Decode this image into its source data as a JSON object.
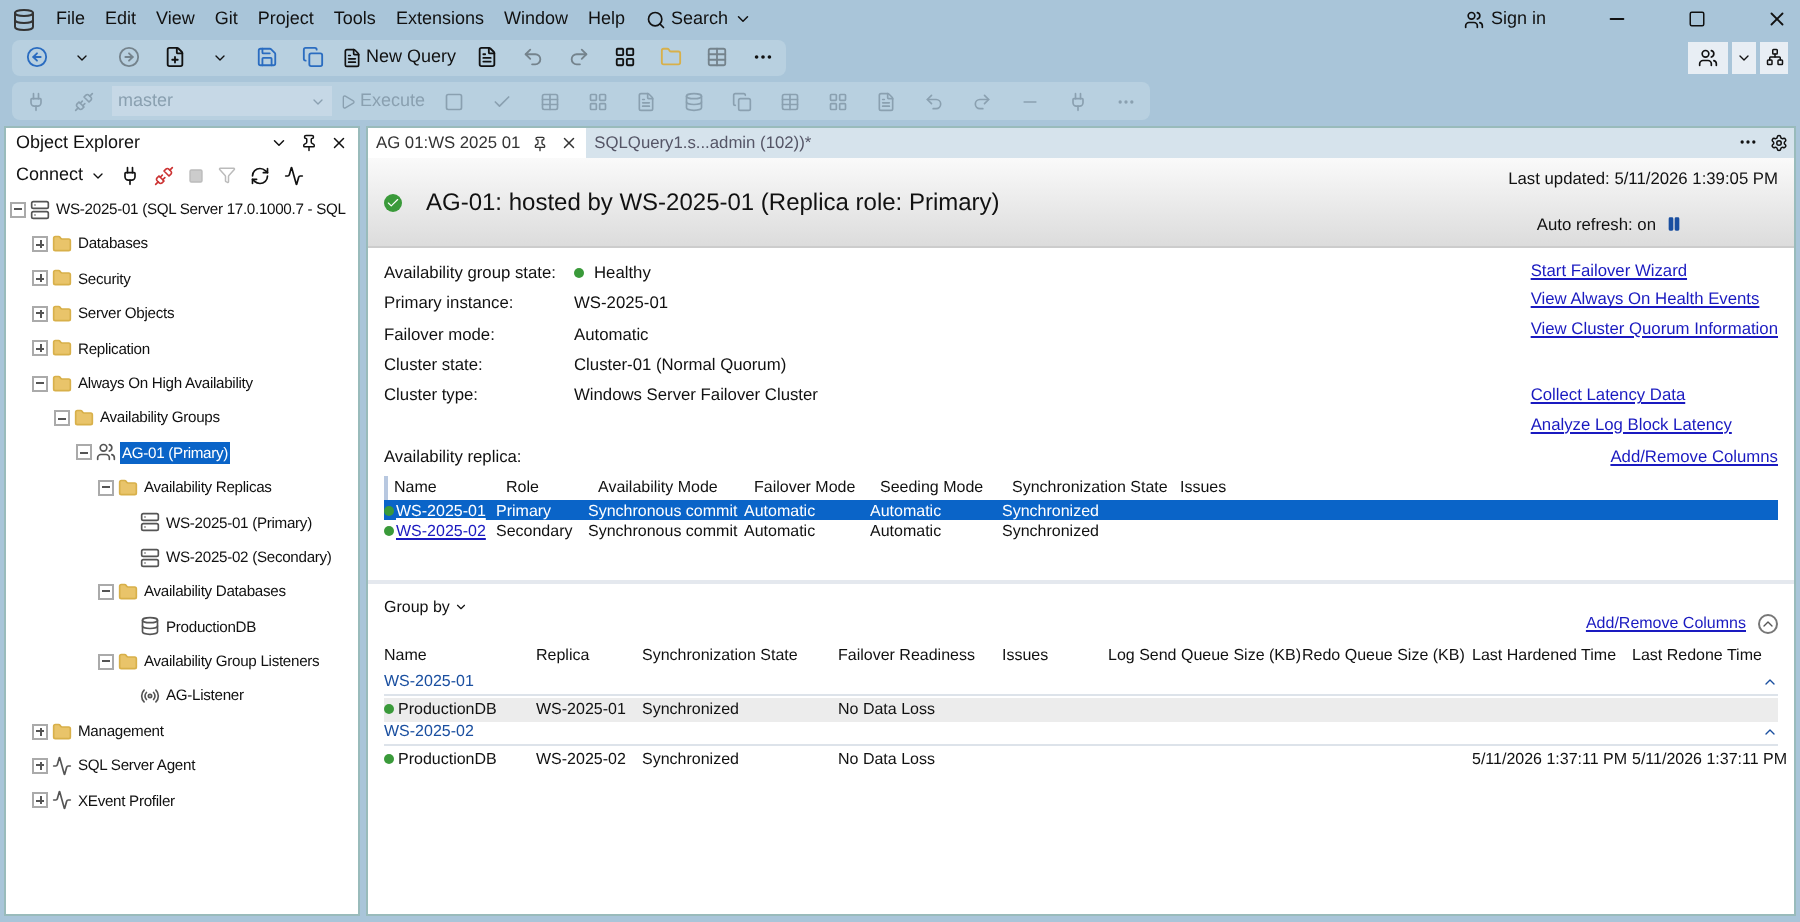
{
  "menu": [
    "File",
    "Edit",
    "View",
    "Git",
    "Project",
    "Tools",
    "Extensions",
    "Window",
    "Help"
  ],
  "search": {
    "label": "Search"
  },
  "sign_in": "Sign in",
  "toolbar": {
    "new_query": "New Query"
  },
  "query_toolbar": {
    "database": "master",
    "execute": "Execute",
    "disabled": true
  },
  "object_explorer": {
    "title": "Object Explorer",
    "connect": "Connect",
    "tree": [
      {
        "label": "WS-2025-01 (SQL Server 17.0.1000.7 - SQL",
        "kind": "server",
        "expanded": true,
        "selected": false,
        "children": [
          {
            "label": "Databases",
            "kind": "folder",
            "expanded": false,
            "selected": false
          },
          {
            "label": "Security",
            "kind": "folder",
            "expanded": false,
            "selected": false
          },
          {
            "label": "Server Objects",
            "kind": "folder",
            "expanded": false,
            "selected": false
          },
          {
            "label": "Replication",
            "kind": "folder",
            "expanded": false,
            "selected": false
          },
          {
            "label": "Always On High Availability",
            "kind": "folder",
            "expanded": true,
            "selected": false,
            "children": [
              {
                "label": "Availability Groups",
                "kind": "folder",
                "expanded": true,
                "selected": false,
                "children": [
                  {
                    "label": "AG-01 (Primary)",
                    "kind": "group",
                    "expanded": true,
                    "selected": true,
                    "children": [
                      {
                        "label": "Availability Replicas",
                        "kind": "folder",
                        "expanded": true,
                        "selected": false,
                        "children": [
                          {
                            "label": "WS-2025-01 (Primary)",
                            "kind": "replica",
                            "selected": false
                          },
                          {
                            "label": "WS-2025-02 (Secondary)",
                            "kind": "replica",
                            "selected": false
                          }
                        ]
                      },
                      {
                        "label": "Availability Databases",
                        "kind": "folder",
                        "expanded": true,
                        "selected": false,
                        "children": [
                          {
                            "label": "ProductionDB",
                            "kind": "database",
                            "selected": false
                          }
                        ]
                      },
                      {
                        "label": "Availability Group Listeners",
                        "kind": "folder",
                        "expanded": true,
                        "selected": false,
                        "children": [
                          {
                            "label": "AG-Listener",
                            "kind": "listener",
                            "selected": false
                          }
                        ]
                      }
                    ]
                  }
                ]
              }
            ]
          },
          {
            "label": "Management",
            "kind": "folder",
            "expanded": false,
            "selected": false
          },
          {
            "label": "SQL Server Agent",
            "kind": "agent",
            "expanded": false,
            "selected": false
          },
          {
            "label": "XEvent Profiler",
            "kind": "profiler",
            "expanded": false,
            "selected": false
          }
        ]
      }
    ]
  },
  "tabs": [
    {
      "label": "AG 01:WS 2025 01",
      "selected": true
    },
    {
      "label": "SQLQuery1.s...admin (102))*",
      "selected": false
    }
  ],
  "dashboard": {
    "title": "AG-01: hosted by WS-2025-01 (Replica role: Primary)",
    "last_updated": "Last updated: 5/11/2026 1:39:05 PM",
    "auto_refresh": "Auto refresh: on",
    "properties": [
      {
        "label": "Availability group state:",
        "value": "Healthy",
        "color": "#3a9a3a"
      },
      {
        "label": "Primary instance:",
        "value": "WS-2025-01"
      },
      {
        "label": "Failover mode:",
        "value": "Automatic"
      },
      {
        "label": "Cluster state:",
        "value": "Cluster-01 (Normal Quorum)"
      },
      {
        "label": "Cluster type:",
        "value": "Windows Server Failover Cluster"
      }
    ],
    "links": [
      "Start Failover Wizard",
      "View Always On Health Events",
      "View Cluster Quorum Information",
      "Collect Latency Data",
      "Analyze Log Block Latency"
    ],
    "replica_label": "Availability replica:",
    "replica_add_remove": "Add/Remove Columns",
    "replica_columns": [
      "Name",
      "Role",
      "Availability Mode",
      "Failover Mode",
      "Seeding Mode",
      "Synchronization State",
      "Issues"
    ],
    "replica_rows": [
      {
        "cells": [
          "WS-2025-01",
          "Primary",
          "Synchronous commit",
          "Automatic",
          "Automatic",
          "Synchronized"
        ],
        "selected": true,
        "color": "#3a9a3a"
      },
      {
        "cells": [
          "WS-2025-02",
          "Secondary",
          "Synchronous commit",
          "Automatic",
          "Automatic",
          "Synchronized"
        ],
        "selected": false,
        "color": "#3a9a3a"
      }
    ],
    "group_by": "Group by",
    "db_add_remove": "Add/Remove Columns",
    "db_columns": [
      "Name",
      "Replica",
      "Synchronization State",
      "Failover Readiness",
      "Issues",
      "Log Send Queue Size (KB)",
      "Redo Queue Size (KB)",
      "Last Hardened Time",
      "Last Redone Time"
    ],
    "db_groups": [
      {
        "name": "WS-2025-01",
        "expanded": true,
        "rows": [
          {
            "cells": [
              "ProductionDB",
              "WS-2025-01",
              "Synchronized",
              "No Data Loss",
              "",
              "",
              "",
              "",
              ""
            ],
            "color": "#3a9a3a",
            "selected": true
          }
        ]
      },
      {
        "name": "WS-2025-02",
        "expanded": true,
        "rows": [
          {
            "cells": [
              "ProductionDB",
              "WS-2025-02",
              "Synchronized",
              "No Data Loss",
              "",
              "",
              "",
              "5/11/2026 1:37:11 PM",
              "5/11/2026 1:37:11 PM"
            ],
            "color": "#3a9a3a",
            "selected": false
          }
        ]
      }
    ]
  }
}
